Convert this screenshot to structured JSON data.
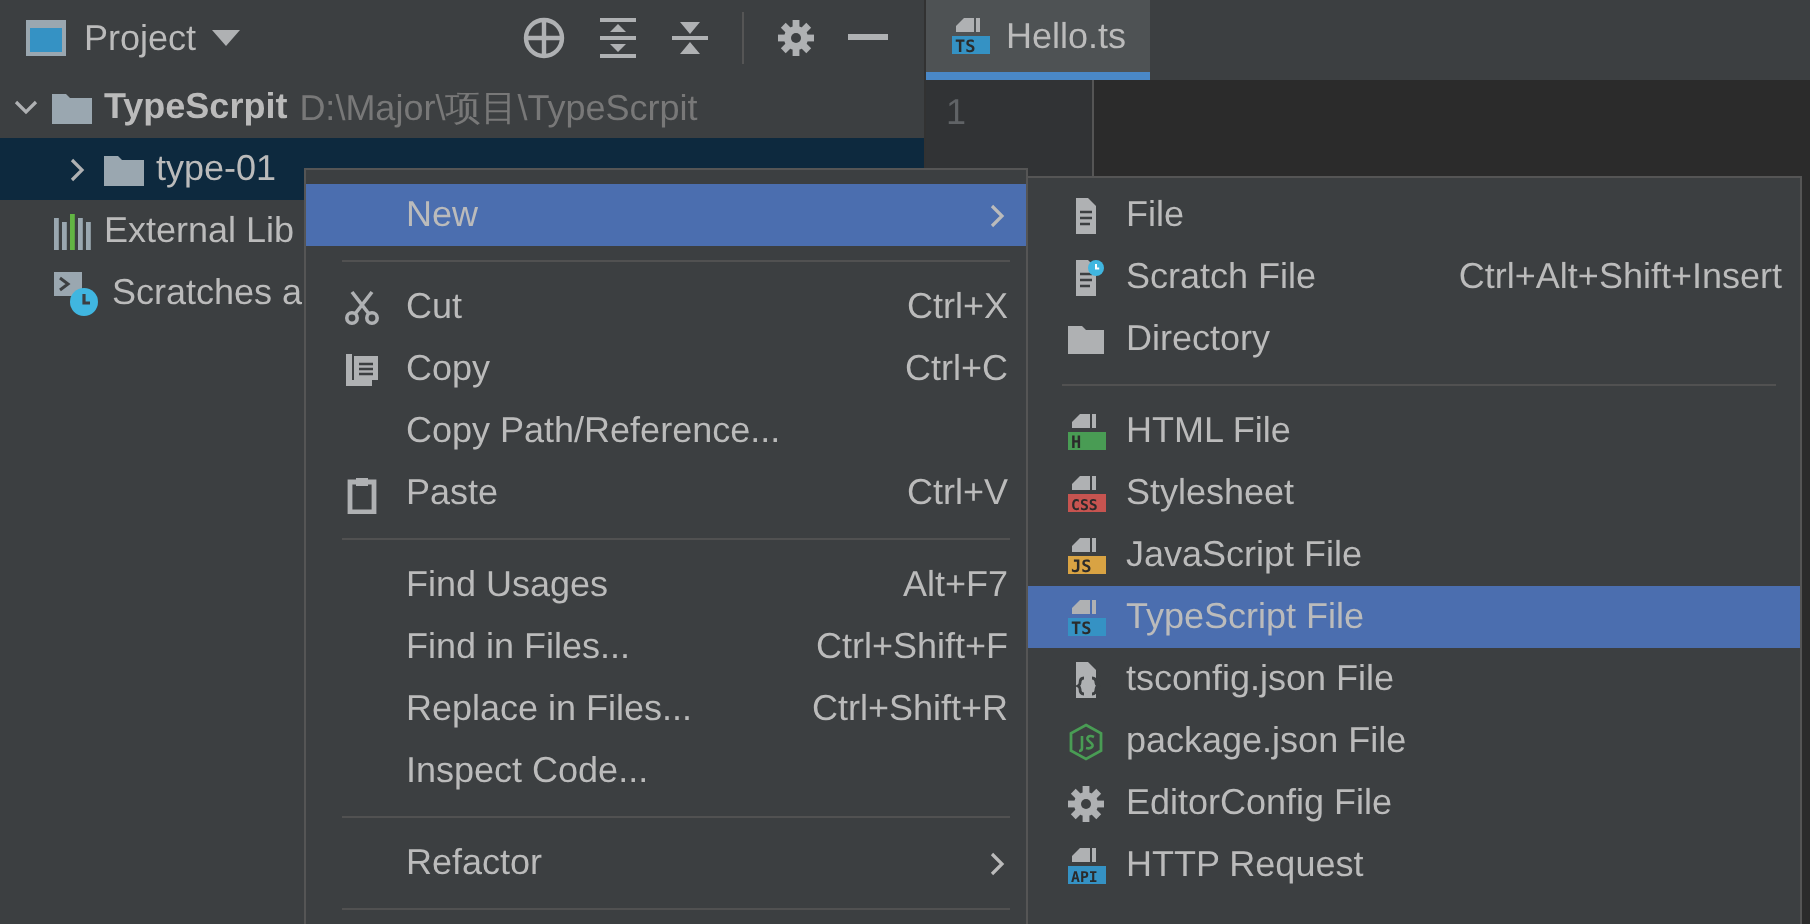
{
  "project_panel": {
    "title": "Project",
    "tree": [
      {
        "kind": "folder",
        "label": "TypeScrpit",
        "path": "D:\\Major\\项目\\TypeScrpit",
        "expanded": true,
        "selected": false,
        "children": [
          {
            "kind": "folder",
            "label": "type-01",
            "expanded": false,
            "selected": true
          }
        ]
      },
      {
        "kind": "libraries",
        "label": "External Lib",
        "selected": false
      },
      {
        "kind": "scratches",
        "label": "Scratches a",
        "selected": false
      }
    ]
  },
  "editor": {
    "tabs": [
      {
        "label": "Hello.ts",
        "badge": "TS",
        "color": "#3592c4",
        "selected": true
      }
    ],
    "line_numbers": [
      "1"
    ]
  },
  "context_menu": {
    "items": [
      {
        "kind": "submenu",
        "label": "New",
        "selected": true
      },
      {
        "kind": "separator"
      },
      {
        "kind": "item",
        "label": "Cut",
        "shortcut": "Ctrl+X",
        "selected": false
      },
      {
        "kind": "item",
        "label": "Copy",
        "shortcut": "Ctrl+C",
        "selected": false
      },
      {
        "kind": "item",
        "label": "Copy Path/Reference...",
        "selected": false
      },
      {
        "kind": "item",
        "label": "Paste",
        "shortcut": "Ctrl+V",
        "selected": false
      },
      {
        "kind": "separator"
      },
      {
        "kind": "item",
        "label": "Find Usages",
        "shortcut": "Alt+F7",
        "selected": false
      },
      {
        "kind": "item",
        "label": "Find in Files...",
        "shortcut": "Ctrl+Shift+F",
        "selected": false
      },
      {
        "kind": "item",
        "label": "Replace in Files...",
        "shortcut": "Ctrl+Shift+R",
        "selected": false
      },
      {
        "kind": "item",
        "label": "Inspect Code...",
        "selected": false
      },
      {
        "kind": "separator"
      },
      {
        "kind": "submenu",
        "label": "Refactor",
        "selected": false
      },
      {
        "kind": "separator"
      }
    ]
  },
  "new_submenu": {
    "items": [
      {
        "kind": "item",
        "label": "File",
        "selected": false
      },
      {
        "kind": "item",
        "label": "Scratch File",
        "shortcut": "Ctrl+Alt+Shift+Insert",
        "selected": false
      },
      {
        "kind": "item",
        "label": "Directory",
        "selected": false
      },
      {
        "kind": "separator"
      },
      {
        "kind": "item",
        "label": "HTML File",
        "badge": "H",
        "color": "#499c54",
        "selected": false
      },
      {
        "kind": "item",
        "label": "Stylesheet",
        "badge": "CSS",
        "color": "#c75450",
        "selected": false
      },
      {
        "kind": "item",
        "label": "JavaScript File",
        "badge": "JS",
        "color": "#d9a343",
        "selected": false
      },
      {
        "kind": "item",
        "label": "TypeScript File",
        "badge": "TS",
        "color": "#3592c4",
        "selected": true
      },
      {
        "kind": "item",
        "label": "tsconfig.json File",
        "selected": false
      },
      {
        "kind": "item",
        "label": "package.json File",
        "selected": false
      },
      {
        "kind": "item",
        "label": "EditorConfig File",
        "selected": false
      },
      {
        "kind": "item",
        "label": "HTTP Request",
        "badge": "API",
        "color": "#3592c4",
        "selected": false
      }
    ]
  }
}
